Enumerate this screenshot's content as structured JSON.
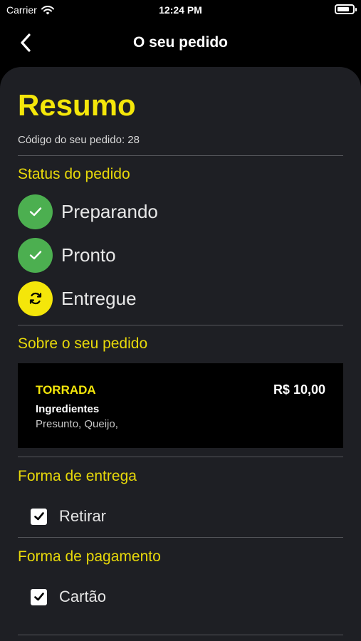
{
  "status_bar": {
    "carrier": "Carrier",
    "time": "12:24 PM",
    "battery_level": 0.8,
    "wifi_icon": "wifi-icon",
    "battery_icon": "battery-icon"
  },
  "nav": {
    "title": "O seu pedido",
    "back_icon": "chevron-left-icon"
  },
  "summary": {
    "title": "Resumo",
    "order_code": "Código do seu pedido: 28"
  },
  "status_section": {
    "title": "Status do pedido",
    "steps": [
      {
        "label": "Preparando",
        "icon": "check-icon",
        "color": "#4caf50"
      },
      {
        "label": "Pronto",
        "icon": "check-icon",
        "color": "#4caf50"
      },
      {
        "label": "Entregue",
        "icon": "refresh-icon",
        "color": "#f4e60a"
      }
    ]
  },
  "order_section": {
    "title": "Sobre o seu pedido",
    "item": {
      "name": "TORRADA",
      "price": "R$ 10,00",
      "ingredients_label": "Ingredientes",
      "ingredients": "Presunto, Queijo,"
    }
  },
  "delivery_section": {
    "title": "Forma de entrega",
    "option": "Retirar",
    "checked": true
  },
  "payment_section": {
    "title": "Forma de pagamento",
    "option": "Cartão",
    "checked": true
  },
  "colors": {
    "accent": "#f4e60a",
    "success": "#4caf50",
    "sheet_background": "#1e1f24",
    "card_background": "#000000"
  }
}
